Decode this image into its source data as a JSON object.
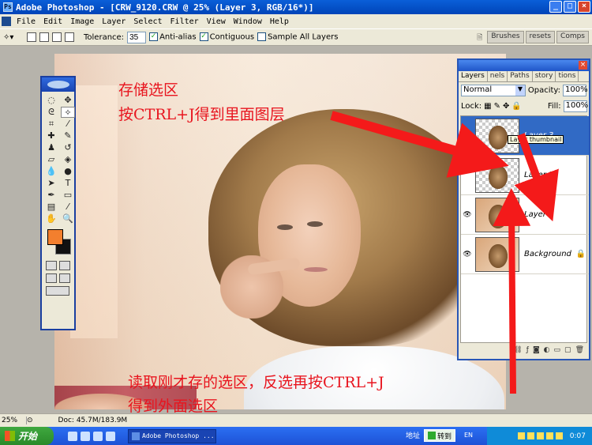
{
  "window": {
    "title": "Adobe Photoshop - [CRW_9120.CRW @ 25% (Layer 3, RGB/16*)]",
    "controls": [
      "_",
      "□",
      "×"
    ]
  },
  "menu": [
    "File",
    "Edit",
    "Image",
    "Layer",
    "Select",
    "Filter",
    "View",
    "Window",
    "Help"
  ],
  "options": {
    "tolerance_label": "Tolerance:",
    "tolerance_value": "35",
    "anti_alias": "Anti-alias",
    "contiguous": "Contiguous",
    "sample_all": "Sample All Layers",
    "well_tabs": [
      "Brushes",
      "resets",
      "Comps"
    ]
  },
  "annotations": {
    "top_line1": "存储选区",
    "top_line2": "按CTRL+J得到里面图层",
    "bottom_line1": "读取刚才存的选区，反选再按CTRL+J",
    "bottom_line2": "得到外面选区"
  },
  "layers_panel": {
    "tabs": [
      "Layers",
      "nels",
      "Paths",
      "story",
      "tions"
    ],
    "blend_mode": "Normal",
    "opacity_label": "Opacity:",
    "opacity": "100%",
    "lock_label": "Lock:",
    "fill_label": "Fill:",
    "fill": "100%",
    "layers": [
      {
        "name": "Layer 3",
        "active": true
      },
      {
        "name": "Layer 2",
        "active": false
      },
      {
        "name": "Layer 1",
        "active": false
      },
      {
        "name": "Background",
        "active": false
      }
    ],
    "tooltip": "Layer thumbnail"
  },
  "status": {
    "zoom": "25%",
    "doc": "Doc: 45.7M/183.9M"
  },
  "taskbar": {
    "start": "开始",
    "task": "Adobe Photoshop ...",
    "address": "地址",
    "goto": "转到",
    "lang": "EN",
    "clock": "0:07"
  },
  "colors": {
    "foreground": "#f37f2e",
    "background": "#000000",
    "annotation": "#e8141e"
  }
}
